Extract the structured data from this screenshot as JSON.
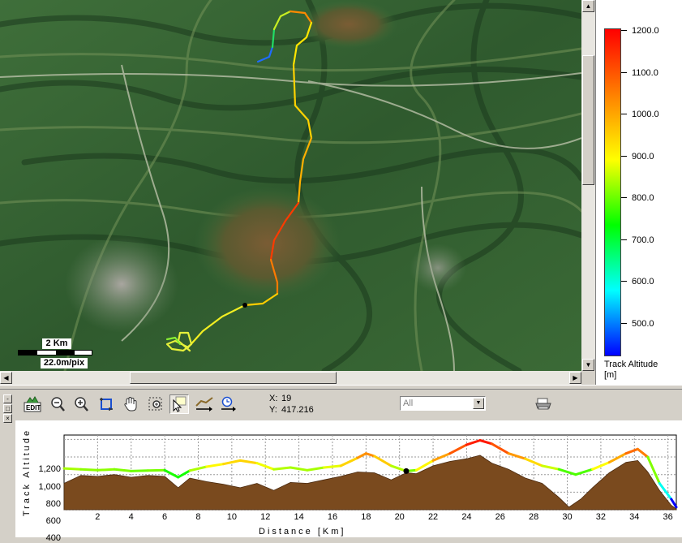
{
  "map": {
    "scale_distance": "2 Km",
    "scale_resolution": "22.0m/pix"
  },
  "legend": {
    "labels": [
      "1200.0",
      "1100.0",
      "1000.0",
      "900.0",
      "800.0",
      "700.0",
      "600.0",
      "500.0"
    ],
    "title_line1": "Track Altitude",
    "title_line2": "[m]",
    "colors": [
      "#ff0000",
      "#ff8000",
      "#ffff00",
      "#00ff00",
      "#00ffff",
      "#0000ff"
    ]
  },
  "toolbar": {
    "icons": [
      "edit-icon",
      "zoom-out-icon",
      "zoom-in-icon",
      "crop-icon",
      "pan-hand-icon",
      "zoom-area-icon",
      "select-arrow-icon",
      "measure-icon",
      "time-icon"
    ],
    "filter_value": "All",
    "print_icon": "printer-icon"
  },
  "side_buttons": [
    "-",
    "□",
    "×"
  ],
  "cursor": {
    "x_label": "X:",
    "x_value": "19",
    "y_label": "Y:",
    "y_value": "417.216"
  },
  "chart_data": {
    "type": "area",
    "xlabel": "Distance [Km]",
    "ylabel": "Track Altitude",
    "xlim": [
      0,
      36.5
    ],
    "ylim": [
      400,
      1250
    ],
    "x_ticks": [
      "2",
      "4",
      "6",
      "8",
      "10",
      "12",
      "14",
      "16",
      "18",
      "20",
      "22",
      "24",
      "26",
      "28",
      "30",
      "32",
      "34",
      "36"
    ],
    "y_ticks": [
      "1,200",
      "1,000",
      "800",
      "600",
      "400"
    ],
    "grid": true,
    "cursor_x": 20.4,
    "series": [
      {
        "x": [
          0,
          1,
          2,
          3,
          4,
          5,
          6,
          6.8,
          7.5,
          8.5,
          9.5,
          10.5,
          11.5,
          12.5,
          13.5,
          14.5,
          15.5,
          16.5,
          17.5,
          18,
          18.5,
          19.5,
          20.4,
          21,
          22,
          23,
          24,
          24.8,
          25.5,
          26.5,
          27.5,
          28.5,
          29.5,
          30.5,
          31.5,
          32.5,
          33.5,
          34.2,
          34.8,
          35.5,
          36.2,
          36.5
        ],
        "values": [
          870,
          860,
          850,
          860,
          840,
          845,
          850,
          770,
          845,
          890,
          920,
          960,
          930,
          860,
          880,
          850,
          880,
          900,
          990,
          1040,
          1010,
          900,
          840,
          850,
          960,
          1040,
          1140,
          1190,
          1150,
          1040,
          980,
          900,
          860,
          800,
          860,
          940,
          1040,
          1090,
          1000,
          700,
          520,
          430
        ]
      },
      {
        "x": [
          0,
          1,
          2,
          3,
          4,
          5,
          6,
          6.8,
          7.5,
          8.5,
          9.5,
          10.5,
          11.5,
          12.5,
          13.5,
          14.5,
          15.5,
          16.5,
          17.5,
          18.5,
          19.5,
          20.4,
          21,
          22,
          23,
          24,
          24.8,
          25.5,
          26.5,
          27.5,
          28.5,
          29.5,
          30.1,
          30.8,
          31.5,
          32.5,
          33.5,
          34.2,
          34.8,
          35.5,
          36.2,
          36.5
        ],
        "values": [
          700,
          790,
          780,
          800,
          770,
          790,
          780,
          650,
          760,
          720,
          690,
          650,
          700,
          620,
          710,
          700,
          740,
          780,
          830,
          820,
          740,
          820,
          810,
          900,
          950,
          980,
          1020,
          930,
          860,
          760,
          700,
          540,
          430,
          520,
          650,
          820,
          940,
          960,
          830,
          620,
          450,
          410
        ]
      }
    ]
  }
}
